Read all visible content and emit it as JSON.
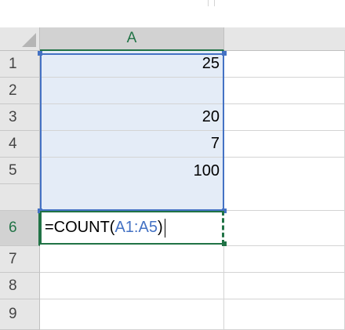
{
  "sheet": {
    "column_headers": [
      "A"
    ],
    "rows": [
      {
        "row": "1",
        "a": "25"
      },
      {
        "row": "2",
        "a": ""
      },
      {
        "row": "3",
        "a": "20"
      },
      {
        "row": "4",
        "a": "7"
      },
      {
        "row": "5",
        "a": "100"
      },
      {
        "row": "6",
        "a": ""
      },
      {
        "row": "7",
        "a": ""
      },
      {
        "row": "8",
        "a": ""
      },
      {
        "row": "9",
        "a": ""
      }
    ],
    "active_cell": {
      "row": "6",
      "formula_prefix": "=COUNT(",
      "formula_ref": "A1:A5",
      "formula_suffix": ")"
    },
    "selected_range": "A1:A5"
  },
  "colors": {
    "accent_green": "#217346",
    "range_blue": "#4472c4",
    "selection_fill": "#e4ecf7"
  }
}
